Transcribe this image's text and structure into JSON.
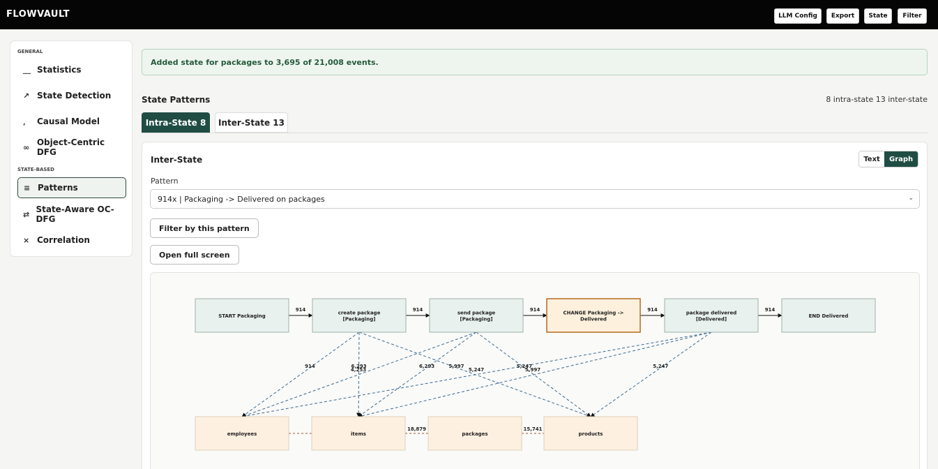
{
  "app": {
    "title": "FLOWVAULT"
  },
  "top_buttons": [
    "LLM Config",
    "Export",
    "State",
    "Filter"
  ],
  "sidebar": {
    "general_label": "GENERAL",
    "state_based_label": "STATE-BASED",
    "items": [
      {
        "label": "Statistics",
        "icon": "bar-chart-icon",
        "glyph": "⸏"
      },
      {
        "label": "State Detection",
        "icon": "line-chart-icon",
        "glyph": "↗"
      },
      {
        "label": "Causal Model",
        "icon": "causal-graph-icon",
        "glyph": "⸲"
      },
      {
        "label": "Object-Centric DFG",
        "icon": "dfg-icon",
        "glyph": "∞"
      },
      {
        "label": "Patterns",
        "icon": "list-icon",
        "glyph": "≡",
        "active": true
      },
      {
        "label": "State-Aware OC-DFG",
        "icon": "flow-icon",
        "glyph": "⇄"
      },
      {
        "label": "Correlation",
        "icon": "correlation-icon",
        "glyph": "⨯"
      }
    ]
  },
  "alert": {
    "text": "Added state for packages to 3,695 of 21,008 events."
  },
  "patterns": {
    "title": "State Patterns",
    "counts": "8 intra-state  13 inter-state",
    "tabs": [
      {
        "label": "Intra-State  8",
        "active": true
      },
      {
        "label": "Inter-State  13",
        "active": false
      }
    ]
  },
  "card": {
    "title": "Inter-State",
    "toggle": {
      "text": "Text",
      "graph": "Graph",
      "selected": "Graph"
    },
    "pattern_label": "Pattern",
    "pattern_value": "914x | Packaging -> Delivered on packages",
    "filter_button": "Filter by this pattern",
    "fullscreen_button": "Open full screen"
  },
  "graph": {
    "colors": {
      "activity_fill": "#e8f1ee",
      "activity_stroke": "#9fb3ad",
      "change_fill": "#fdf0dd",
      "change_stroke": "#b56b1e",
      "object_fill": "#fdf0e0",
      "object_stroke": "#ddd0bc",
      "dashed_edge": "#3a6a92"
    },
    "nodes": [
      {
        "id": "n0",
        "lines": [
          "START Packaging"
        ]
      },
      {
        "id": "n1",
        "lines": [
          "create package",
          "[Packaging]"
        ]
      },
      {
        "id": "n2",
        "lines": [
          "send package",
          "[Packaging]"
        ]
      },
      {
        "id": "n3",
        "lines": [
          "CHANGE Packaging ->",
          "Delivered"
        ],
        "highlight": true
      },
      {
        "id": "n4",
        "lines": [
          "package delivered",
          "[Delivered]"
        ]
      },
      {
        "id": "n5",
        "lines": [
          "END Delivered"
        ]
      }
    ],
    "flow_edges": [
      {
        "from": "n0",
        "to": "n1",
        "label": "914"
      },
      {
        "from": "n1",
        "to": "n2",
        "label": "914"
      },
      {
        "from": "n2",
        "to": "n3",
        "label": "914"
      },
      {
        "from": "n3",
        "to": "n4",
        "label": "914"
      },
      {
        "from": "n4",
        "to": "n5",
        "label": "914"
      }
    ],
    "objects": [
      {
        "id": "o0",
        "label": "employees"
      },
      {
        "id": "o1",
        "label": "items"
      },
      {
        "id": "o2",
        "label": "packages"
      },
      {
        "id": "o3",
        "label": "products"
      }
    ],
    "object_links": [
      {
        "from": "o0",
        "to": "o1",
        "label": ""
      },
      {
        "from": "o1",
        "to": "o2",
        "label": "18,879"
      },
      {
        "from": "o2",
        "to": "o3",
        "label": "15,741"
      }
    ],
    "relation_edges": [
      {
        "from": "n1",
        "to": "o0",
        "label": "914"
      },
      {
        "from": "n1",
        "to": "o1",
        "label": "6,293"
      },
      {
        "from": "n1",
        "to": "o3",
        "label": "5,997"
      },
      {
        "from": "n2",
        "to": "o0",
        "label": ""
      },
      {
        "from": "n2",
        "to": "o1",
        "label": "6,293"
      },
      {
        "from": "n2",
        "to": "o3",
        "label": "5,247"
      },
      {
        "from": "n4",
        "to": "o0",
        "label": ""
      },
      {
        "from": "n4",
        "to": "o1",
        "label": ""
      },
      {
        "from": "n4",
        "to": "o3",
        "label": "5,247"
      }
    ],
    "relation_labels_overlap": [
      {
        "label": "4,253"
      },
      {
        "label": "5,247"
      },
      {
        "label": "5,997"
      }
    ]
  }
}
